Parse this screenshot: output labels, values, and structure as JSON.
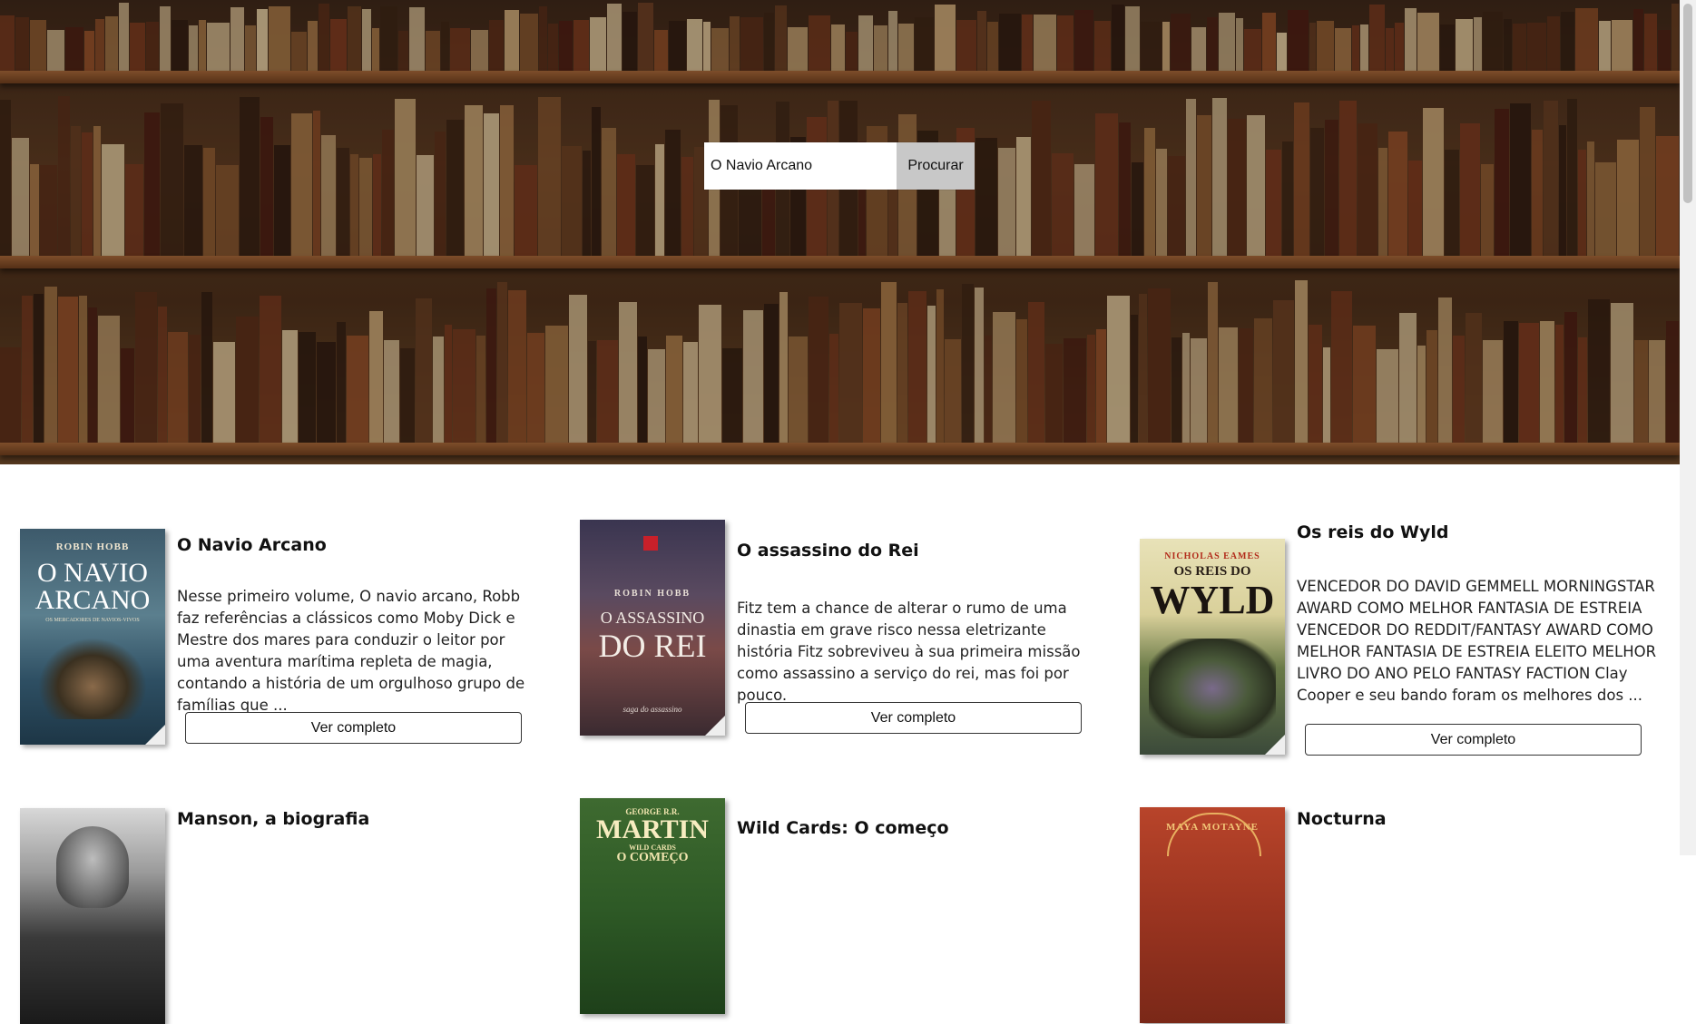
{
  "search": {
    "value": "O Navio Arcano",
    "button_label": "Procurar"
  },
  "books": [
    {
      "title": "O Navio Arcano",
      "description": "Nesse primeiro volume, O navio arcano, Robb faz referências a clássicos como Moby Dick e Mestre dos mares para conduzir o leitor por uma aventura marítima repleta de magia, contando a história de um orgulhoso grupo de famílias que ...",
      "button_label": "Ver completo",
      "cover": {
        "author": "ROBIN HOBB",
        "title_l1": "O NAVIO",
        "title_l2": "ARCANO",
        "subtitle": "OS MERCADORES DE NAVIOS-VIVOS"
      }
    },
    {
      "title": "O assassino do Rei",
      "description": "Fitz tem a chance de alterar o rumo de uma dinastia em grave risco nessa eletrizante história Fitz sobreviveu à sua primeira missão como assassino a serviço do rei, mas foi por pouco.",
      "button_label": "Ver completo",
      "cover": {
        "author": "ROBIN HOBB",
        "title_l1": "O ASSASSINO",
        "title_l2": "DO REI",
        "subtitle": "saga do assassino"
      }
    },
    {
      "title": "Os reis do Wyld",
      "description": "VENCEDOR DO DAVID GEMMELL MORNINGSTAR AWARD COMO MELHOR FANTASIA DE ESTREIA VENCEDOR DO REDDIT/FANTASY AWARD COMO MELHOR FANTASIA DE ESTREIA ELEITO MELHOR LIVRO DO ANO PELO FANTASY FACTION Clay Cooper e seu bando foram os melhores dos ...",
      "button_label": "Ver completo",
      "cover": {
        "author": "NICHOLAS EAMES",
        "title_l1": "OS REIS DO",
        "title_l2": "WYLD",
        "subtitle": ""
      }
    },
    {
      "title": "Manson, a biografia",
      "cover": {
        "author": "",
        "title_l1": "",
        "title_l2": "",
        "subtitle": ""
      }
    },
    {
      "title": "Wild Cards: O começo",
      "cover": {
        "author": "GEORGE R.R.",
        "title_l1": "MARTIN",
        "title_l2": "WILD CARDS",
        "subtitle": "O COMEÇO"
      }
    },
    {
      "title": "Nocturna",
      "cover": {
        "author": "MAYA MOTAYNE",
        "title_l1": "",
        "title_l2": "",
        "subtitle": ""
      }
    }
  ],
  "colors": {
    "page_bg": "#ffffff",
    "search_button_bg": "#c8c8c8",
    "text": "#111111"
  }
}
